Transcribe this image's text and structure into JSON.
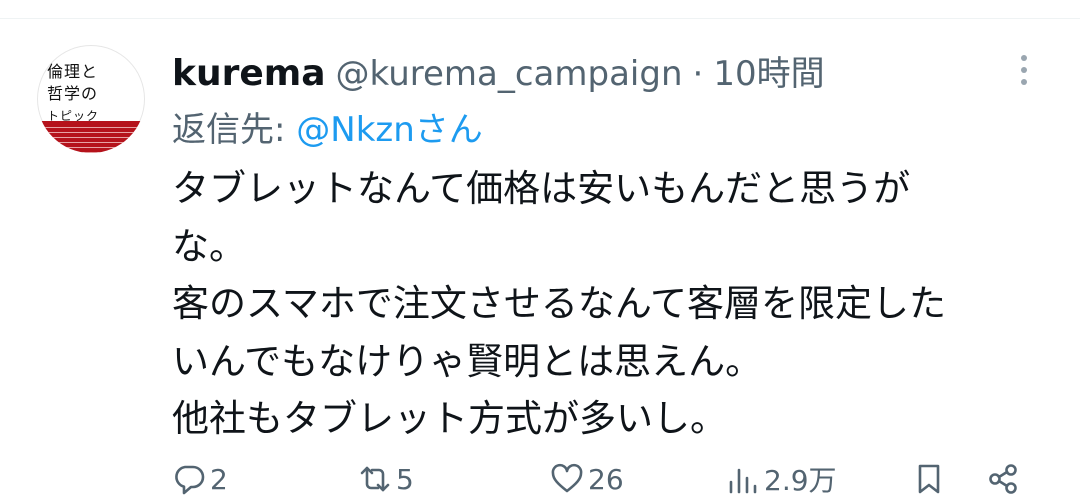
{
  "tweet": {
    "author": {
      "name": "kurema",
      "handle": "@kurema_campaign",
      "avatar_text": [
        "倫理と",
        "哲学の",
        "トピック"
      ]
    },
    "separator": "·",
    "time": "10時間",
    "reply": {
      "prefix": "返信先:",
      "mention": "@Nkznさん"
    },
    "body_lines": [
      "タブレットなんて価格は安いもんだと思うが",
      "な。",
      "客のスマホで注文させるなんて客層を限定した",
      "いんでもなけりゃ賢明とは思えん。",
      "他社もタブレット方式が多いし。"
    ],
    "actions": {
      "reply": {
        "icon": "reply-icon",
        "count": "2"
      },
      "retweet": {
        "icon": "retweet-icon",
        "count": "5"
      },
      "like": {
        "icon": "heart-icon",
        "count": "26"
      },
      "views": {
        "icon": "views-icon",
        "count": "2.9万"
      },
      "bookmark": {
        "icon": "bookmark-icon"
      },
      "share": {
        "icon": "share-icon"
      }
    }
  }
}
